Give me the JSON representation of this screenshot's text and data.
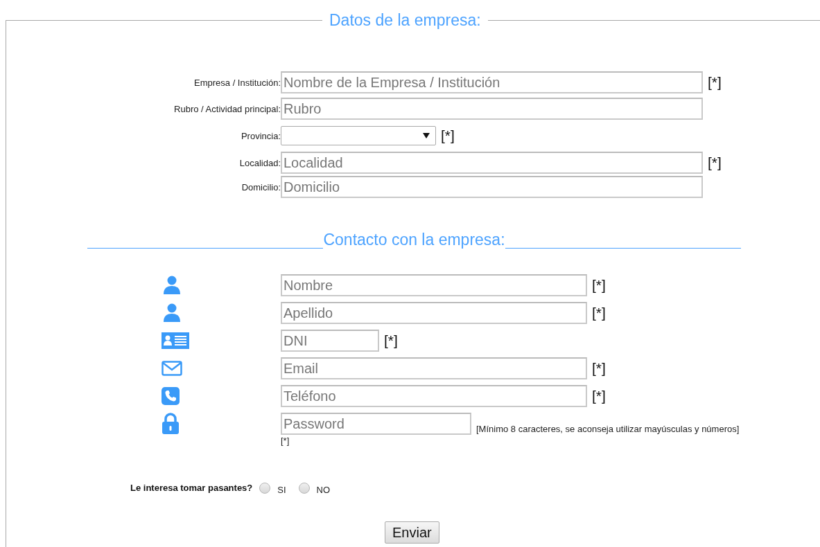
{
  "section_title": "Datos de la empresa:",
  "company_fields": [
    {
      "label": "Empresa / Institución:",
      "kind": "text",
      "placeholder": "Nombre de la Empresa / Institución",
      "mark": "[*]"
    },
    {
      "label": "Rubro / Actividad principal:",
      "kind": "text",
      "placeholder": "Rubro"
    },
    {
      "label": "Provincia:",
      "kind": "select",
      "mark": "[*]"
    },
    {
      "label": "Localidad:",
      "kind": "text",
      "placeholder": "Localidad",
      "mark": "[*]"
    },
    {
      "label": "Domicilio:",
      "kind": "text",
      "placeholder": "Domicilio"
    }
  ],
  "contact": {
    "title": "Contacto con la empresa:",
    "fields": [
      {
        "kind": "person",
        "placeholder": "Nombre",
        "mark": "[*]"
      },
      {
        "kind": "person",
        "placeholder": "Apellido",
        "mark": "[*]"
      },
      {
        "kind": "id-card",
        "placeholder": "DNI",
        "mark": "[*]"
      },
      {
        "kind": "envelope",
        "placeholder": "Email",
        "mark": "[*]"
      },
      {
        "kind": "phone",
        "placeholder": "Teléfono",
        "mark": "[*]"
      },
      {
        "kind": "lock",
        "placeholder": "Password",
        "hint": "[Mínimo 8 caracteres, se aconseja utilizar mayúsculas y números][*]"
      }
    ]
  },
  "question": {
    "label": "Le interesa tomar pasantes?",
    "options": [
      {
        "label": "SI",
        "selected": false
      },
      {
        "label": "NO",
        "selected": false
      }
    ]
  },
  "submit": "Enviar"
}
